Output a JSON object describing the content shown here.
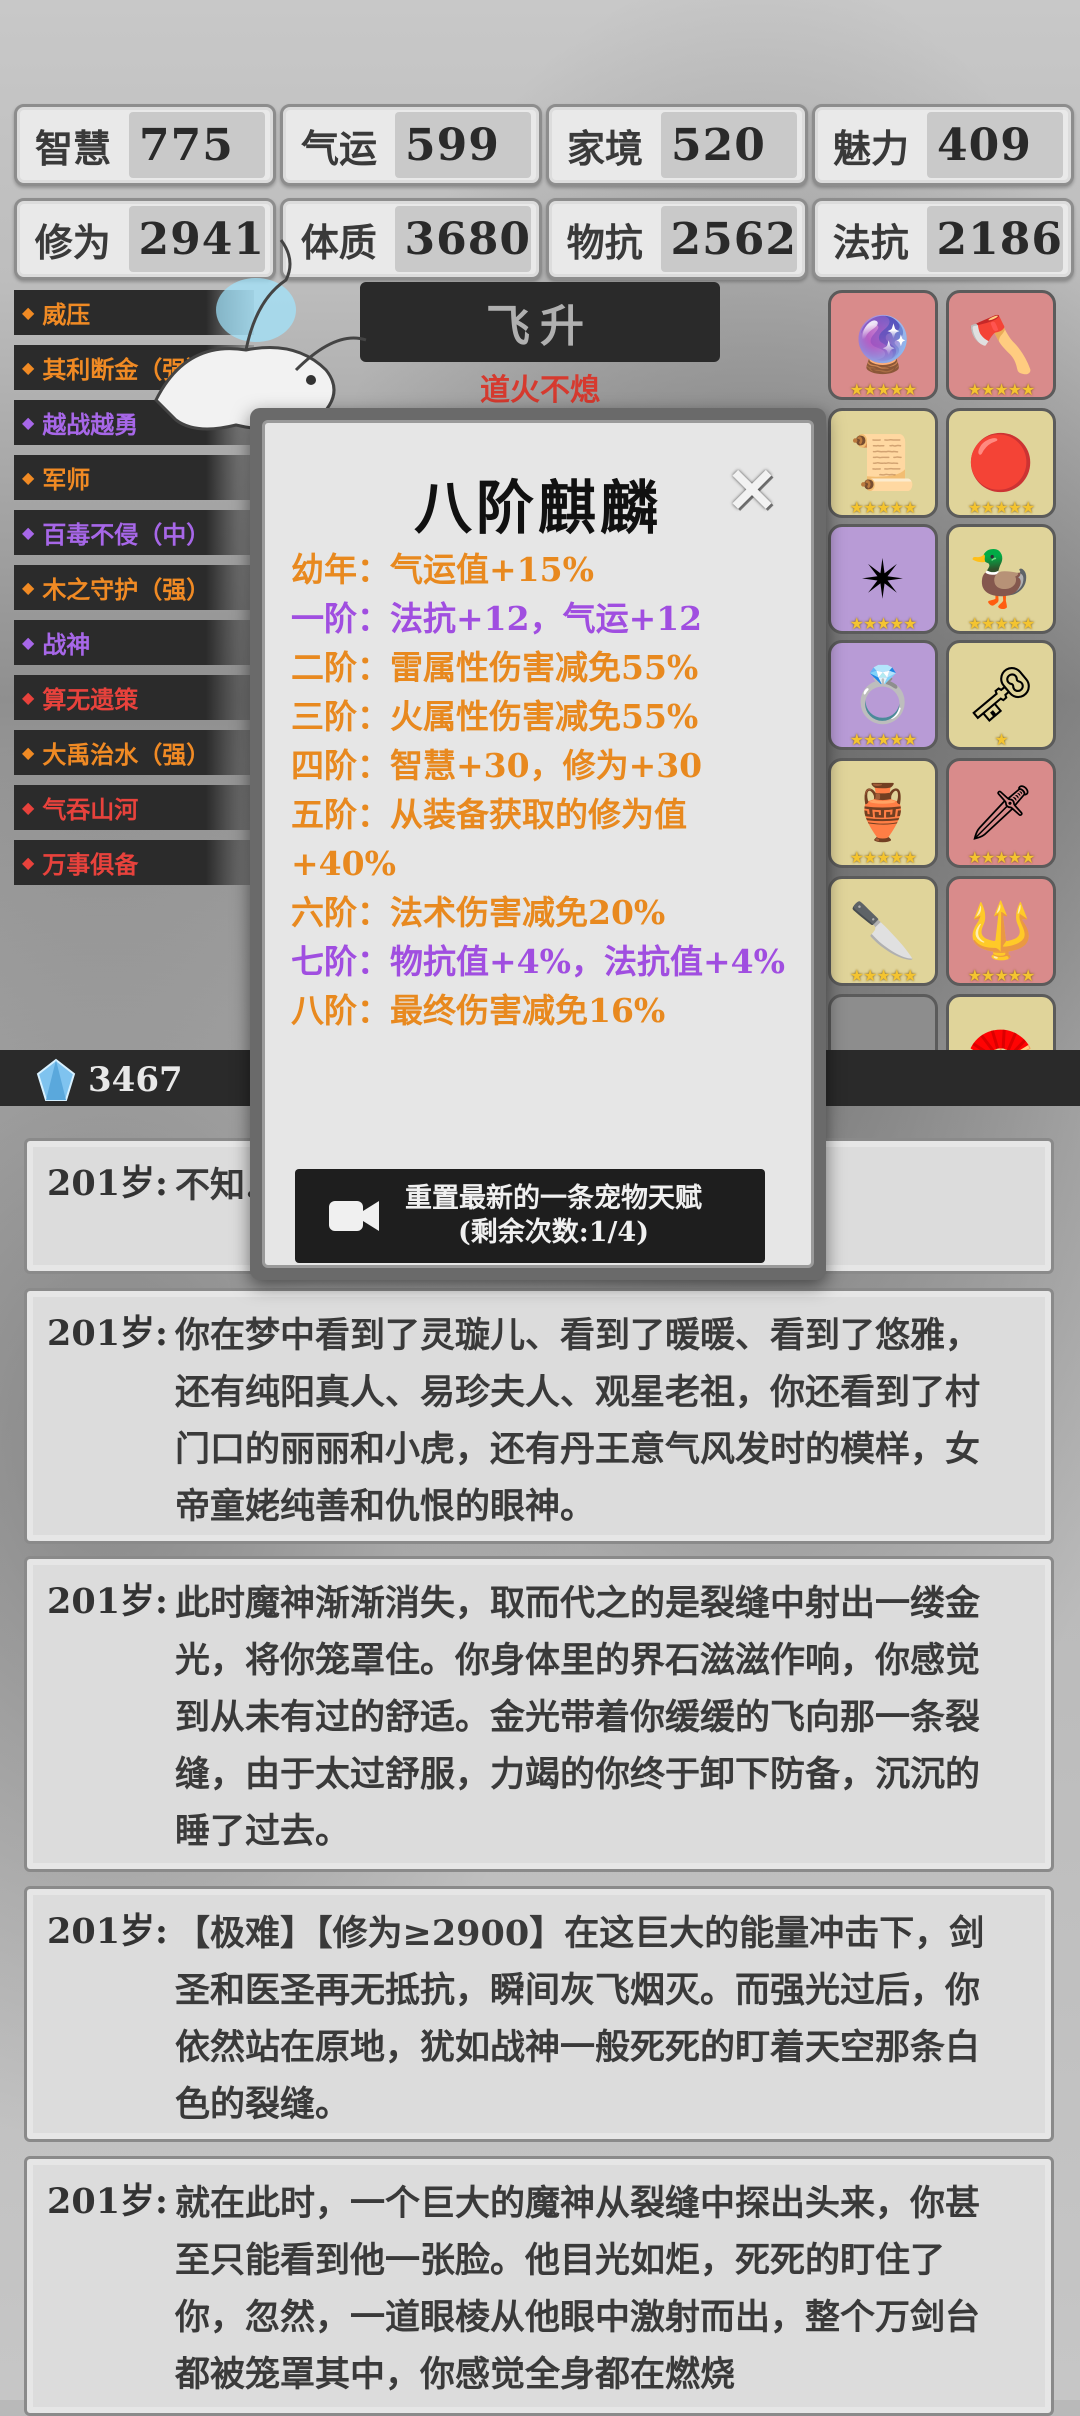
{
  "stats": [
    {
      "label": "智慧",
      "value": "775"
    },
    {
      "label": "气运",
      "value": "599"
    },
    {
      "label": "家境",
      "value": "520"
    },
    {
      "label": "魅力",
      "value": "409"
    },
    {
      "label": "修为",
      "value": "2941"
    },
    {
      "label": "体质",
      "value": "3680"
    },
    {
      "label": "物抗",
      "value": "2562"
    },
    {
      "label": "法抗",
      "value": "2186"
    }
  ],
  "talents": [
    {
      "label": "威压",
      "color": "orange"
    },
    {
      "label": "其利断金（强）",
      "color": "orange"
    },
    {
      "label": "越战越勇",
      "color": "purple"
    },
    {
      "label": "军师",
      "color": "orange"
    },
    {
      "label": "百毒不侵（中）",
      "color": "purple"
    },
    {
      "label": "木之守护（强）",
      "color": "orange"
    },
    {
      "label": "战神",
      "color": "purple"
    },
    {
      "label": "算无遗策",
      "color": "red"
    },
    {
      "label": "大禹治水（强）",
      "color": "orange"
    },
    {
      "label": "气吞山河",
      "color": "red"
    },
    {
      "label": "万事俱备",
      "color": "red"
    }
  ],
  "banner": {
    "title": "飞升",
    "subtitle": "道火不熄"
  },
  "currency": {
    "icon": "crystal-icon",
    "value": "3467"
  },
  "equipment": [
    {
      "icon": "orb",
      "color": "red",
      "stars": "★★★★★"
    },
    {
      "icon": "axe",
      "color": "red",
      "stars": "★★★★★"
    },
    {
      "icon": "scroll",
      "color": "gold",
      "stars": "★★★★★"
    },
    {
      "icon": "fire-orb",
      "color": "gold",
      "stars": "★★★★★"
    },
    {
      "icon": "amulet",
      "color": "purple",
      "stars": "★★★★★"
    },
    {
      "icon": "bird-figurine",
      "color": "gold",
      "stars": "★★★★★"
    },
    {
      "icon": "ring",
      "color": "purple",
      "stars": "★★★★★"
    },
    {
      "icon": "scepter",
      "color": "gold",
      "stars": "★"
    },
    {
      "icon": "cauldron",
      "color": "gold",
      "stars": "★★★★★"
    },
    {
      "icon": "sword",
      "color": "red",
      "stars": "★★★★★"
    },
    {
      "icon": "dagger",
      "color": "gold",
      "stars": "★★★★★"
    },
    {
      "icon": "spear",
      "color": "red",
      "stars": "★★★★★"
    },
    {
      "icon": "",
      "color": "empty",
      "stars": ""
    },
    {
      "icon": "fan",
      "color": "gold",
      "stars": "★"
    }
  ],
  "modal": {
    "title": "八阶麒麟",
    "tiers": [
      {
        "text": "幼年：气运值+15%",
        "color": "orange"
      },
      {
        "text": "一阶：法抗+12，气运+12",
        "color": "purple"
      },
      {
        "text": "二阶：雷属性伤害减免55%",
        "color": "orange"
      },
      {
        "text": "三阶：火属性伤害减免55%",
        "color": "orange"
      },
      {
        "text": "四阶：智慧+30，修为+30",
        "color": "orange"
      },
      {
        "text": "五阶：从装备获取的修为值+40%",
        "color": "orange"
      },
      {
        "text": "六阶：法术伤害减免20%",
        "color": "orange"
      },
      {
        "text": "七阶：物抗值+4%，法抗值+4%",
        "color": "purple"
      },
      {
        "text": "八阶：最终伤害减免16%",
        "color": "orange"
      }
    ],
    "reset_line1": "重置最新的一条宠物天赋",
    "reset_line2": "(剩余次数:1/4)"
  },
  "story": [
    {
      "age": "201岁:",
      "text": "不知……你缓缓的睁开"
    },
    {
      "age": "201岁:",
      "text": "你在梦中看到了灵璇儿、看到了暖暖、看到了悠雅，还有纯阳真人、易珍夫人、观星老祖，你还看到了村门口的丽丽和小虎，还有丹王意气风发时的模样，女帝童姥纯善和仇恨的眼神。"
    },
    {
      "age": "201岁:",
      "text": "此时魔神渐渐消失，取而代之的是裂缝中射出一缕金光，将你笼罩住。你身体里的界石滋滋作响，你感觉到从未有过的舒适。金光带着你缓缓的飞向那一条裂缝，由于太过舒服，力竭的你终于卸下防备，沉沉的睡了过去。"
    },
    {
      "age": "201岁:",
      "text": "【极难】【修为≥2900】在这巨大的能量冲击下，剑圣和医圣再无抵抗，瞬间灰飞烟灭。而强光过后，你依然站在原地，犹如战神一般死死的盯着天空那条白色的裂缝。"
    },
    {
      "age": "201岁:",
      "text": "就在此时，一个巨大的魔神从裂缝中探出头来，你甚至只能看到他一张脸。他目光如炬，死死的盯住了你，忽然，一道眼棱从他眼中激射而出，整个万剑台都被笼罩其中，你感觉全身都在燃烧"
    }
  ]
}
